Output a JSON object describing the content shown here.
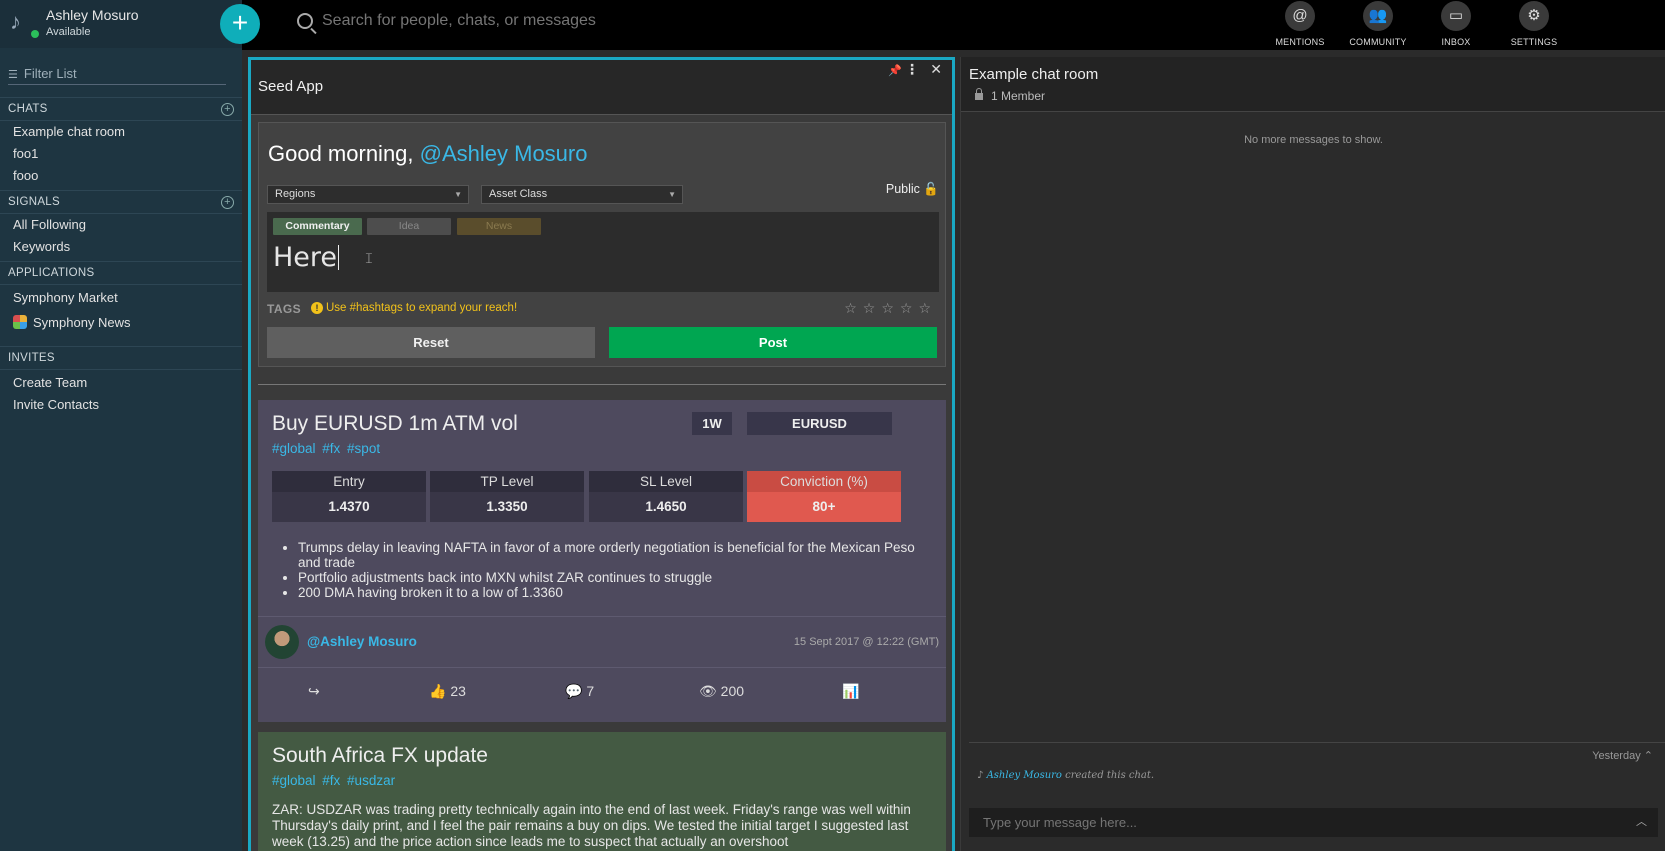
{
  "profile": {
    "name": "Ashley Mosuro",
    "status": "Available"
  },
  "compose_label": "+",
  "filter_placeholder": "Filter List",
  "search": {
    "placeholder": "Search for people, chats, or messages"
  },
  "nav": [
    {
      "label": "MENTIONS",
      "glyph": "@"
    },
    {
      "label": "COMMUNITY",
      "glyph": "👥"
    },
    {
      "label": "INBOX",
      "glyph": "▭"
    },
    {
      "label": "SETTINGS",
      "glyph": "⚙"
    }
  ],
  "sidebar": {
    "chats": {
      "title": "CHATS",
      "items": [
        "Example chat room",
        "foo1",
        "fooo"
      ]
    },
    "signals": {
      "title": "SIGNALS",
      "items": [
        "All Following",
        "Keywords"
      ]
    },
    "applications": {
      "title": "APPLICATIONS",
      "items": [
        "Symphony Market",
        "Symphony News"
      ]
    },
    "invites": {
      "title": "INVITES",
      "items": [
        "Create Team",
        "Invite Contacts"
      ]
    }
  },
  "seed": {
    "title": "Seed App",
    "greeting": "Good morning, ",
    "mention": "@Ashley Mosuro",
    "regions": "Regions",
    "asset_class": "Asset Class",
    "visibility": "Public",
    "tabs": {
      "commentary": "Commentary",
      "idea": "Idea",
      "news": "News"
    },
    "draft_text": "Here",
    "tags_label": "TAGS",
    "tags_hint": "Use #hashtags to expand your reach!",
    "stars": "☆☆☆☆☆",
    "reset": "Reset",
    "post": "Post"
  },
  "card1": {
    "title": "Buy EURUSD 1m ATM vol",
    "hashtags": "#global #fx #spot",
    "tenor": "1W",
    "pair": "EURUSD",
    "metrics": [
      {
        "label": "Entry",
        "value": "1.4370"
      },
      {
        "label": "TP Level",
        "value": "1.3350"
      },
      {
        "label": "SL Level",
        "value": "1.4650"
      },
      {
        "label": "Conviction (%)",
        "value": "80+"
      }
    ],
    "bullets": [
      "Trumps delay in leaving NAFTA in favor of a more orderly negotiation is beneficial for the Mexican Peso and trade",
      "Portfolio adjustments back into MXN whilst ZAR continues to struggle",
      "200 DMA having broken it to a low of 1.3360"
    ],
    "author": "@Ashley Mosuro",
    "date": "15 Sept 2017 @ 12:22 (GMT)",
    "likes": "23",
    "comments": "7",
    "views": "200"
  },
  "card2": {
    "title": "South Africa FX update",
    "hashtags": "#global #fx #usdzar",
    "body": "ZAR: USDZAR was trading pretty technically again into the end of last week. Friday's range was well within Thursday's daily print, and I feel the pair remains a buy on dips. We tested the initial target I suggested last week (13.25) and the price action since leads me to suspect that actually an overshoot"
  },
  "chat": {
    "title": "Example chat room",
    "members": "1 Member",
    "no_more": "No more messages to show.",
    "yesterday": "Yesterday",
    "creator": "Ashley Mosuro",
    "created_suffix": " created this chat.",
    "input_placeholder": "Type your message here..."
  },
  "colors": {
    "accent": "#1aa8c3",
    "post": "#00a651",
    "conviction": "#e0594f",
    "sidebar": "#1e3541",
    "mention": "#3ab8e6",
    "hint": "#f2c21a"
  }
}
